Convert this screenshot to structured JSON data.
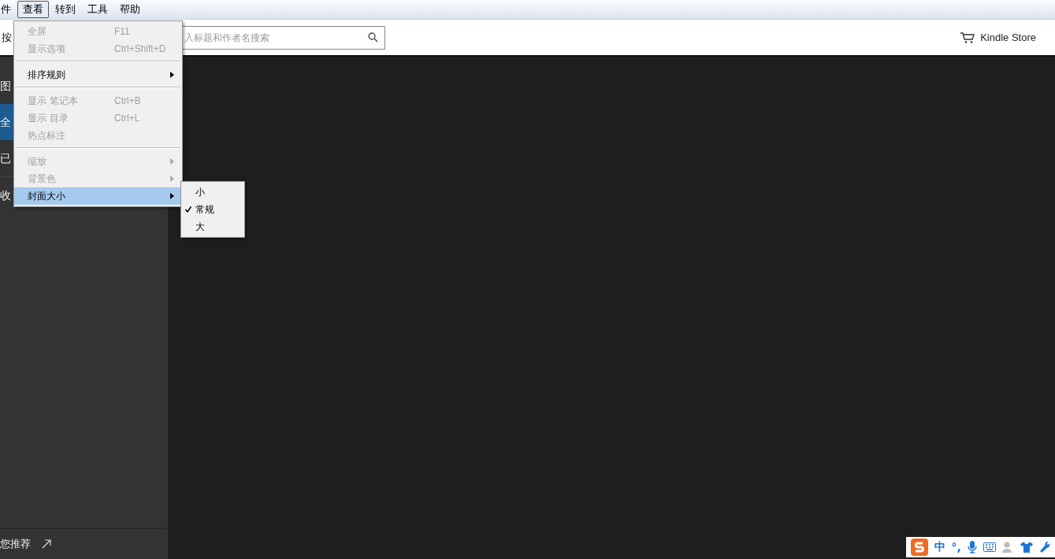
{
  "menu_bar": {
    "items": [
      {
        "label": "件",
        "selected": false
      },
      {
        "label": "查看",
        "selected": true
      },
      {
        "label": "转到",
        "selected": false
      },
      {
        "label": "工具",
        "selected": false
      },
      {
        "label": "帮助",
        "selected": false
      }
    ]
  },
  "toolbar": {
    "left_label": "按",
    "search": {
      "placeholder": "入标题和作者名搜索"
    },
    "store_link": "Kindle Store"
  },
  "sidebar": {
    "items": [
      {
        "label": "图",
        "selected": false
      },
      {
        "label": "全",
        "selected": true
      },
      {
        "label": "已",
        "selected": false
      },
      {
        "label": "收",
        "selected": false
      }
    ],
    "recommend_link": "您推荐"
  },
  "view_menu": {
    "items": [
      {
        "kind": "item",
        "label": "全屏",
        "shortcut": "F11",
        "disabled": true,
        "submenu": false,
        "highlighted": false
      },
      {
        "kind": "item",
        "label": "显示选项",
        "shortcut": "Ctrl+Shift+D",
        "disabled": true,
        "submenu": false,
        "highlighted": false
      },
      {
        "kind": "separator"
      },
      {
        "kind": "item",
        "label": "排序规则",
        "disabled": false,
        "submenu": true,
        "highlighted": false
      },
      {
        "kind": "separator"
      },
      {
        "kind": "item",
        "label": "显示 笔记本",
        "shortcut": "Ctrl+B",
        "disabled": true,
        "submenu": false,
        "highlighted": false
      },
      {
        "kind": "item",
        "label": "显示 目录",
        "shortcut": "Ctrl+L",
        "disabled": true,
        "submenu": false,
        "highlighted": false
      },
      {
        "kind": "item",
        "label": "热点标注",
        "disabled": true,
        "submenu": false,
        "highlighted": false
      },
      {
        "kind": "separator"
      },
      {
        "kind": "item",
        "label": "缩放",
        "disabled": true,
        "submenu": true,
        "highlighted": false
      },
      {
        "kind": "item",
        "label": "背景色",
        "disabled": true,
        "submenu": true,
        "highlighted": false
      },
      {
        "kind": "item",
        "label": "封面大小",
        "disabled": false,
        "submenu": true,
        "highlighted": true
      }
    ]
  },
  "cover_size_submenu": {
    "items": [
      {
        "label": "小",
        "checked": false
      },
      {
        "label": "常规",
        "checked": true
      },
      {
        "label": "大",
        "checked": false
      }
    ]
  },
  "ime_bar": {
    "mode": "中",
    "punctuation": "°,"
  }
}
